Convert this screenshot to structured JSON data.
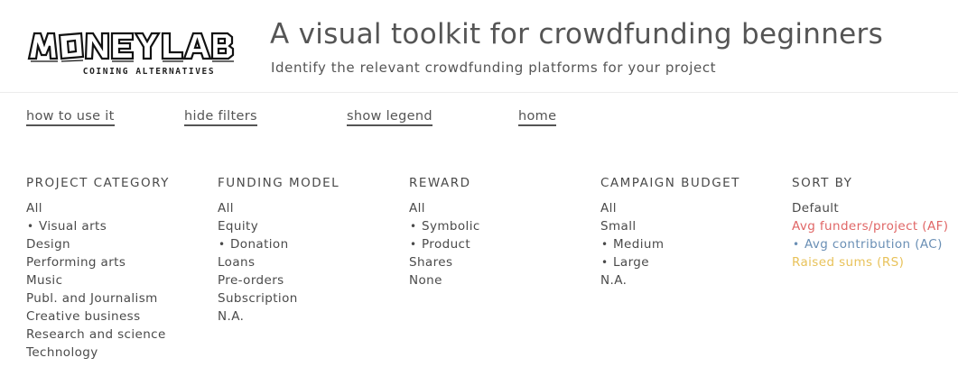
{
  "logo": {
    "brand": "MONEYLAB",
    "tagline": "COINING ALTERNATIVES"
  },
  "header": {
    "title": "A visual toolkit for crowdfunding beginners",
    "subtitle": "Identify the relevant crowdfunding platforms for your project"
  },
  "nav": {
    "how_to": "how to use it",
    "hide_filters": "hide filters",
    "show_legend": "show legend",
    "home": "home"
  },
  "filters": {
    "project_category": {
      "heading": "PROJECT CATEGORY",
      "options": [
        "All",
        "Visual arts",
        "Design",
        "Performing arts",
        "Music",
        "Publ. and Journalism",
        "Creative business",
        "Research and science",
        "Technology"
      ],
      "selected": [
        "Visual arts"
      ]
    },
    "funding_model": {
      "heading": "FUNDING MODEL",
      "options": [
        "All",
        "Equity",
        "Donation",
        "Loans",
        "Pre-orders",
        "Subscription",
        "N.A."
      ],
      "selected": [
        "Donation"
      ]
    },
    "reward": {
      "heading": "REWARD",
      "options": [
        "All",
        "Symbolic",
        "Product",
        "Shares",
        "None"
      ],
      "selected": [
        "Symbolic",
        "Product"
      ]
    },
    "campaign_budget": {
      "heading": "CAMPAIGN BUDGET",
      "options": [
        "All",
        "Small",
        "Medium",
        "Large",
        "N.A."
      ],
      "selected": [
        "Medium",
        "Large"
      ]
    },
    "sort_by": {
      "heading": "SORT BY",
      "options": [
        "Default",
        "Avg funders/project (AF)",
        "Avg contribution (AC)",
        "Raised sums (RS)"
      ],
      "selected": [
        "Avg contribution (AC)"
      ]
    }
  },
  "colors": {
    "text": "#4a4a4a",
    "sort_af": "#e06666",
    "sort_ac": "#6a8fb5",
    "sort_rs": "#e8c25a"
  }
}
